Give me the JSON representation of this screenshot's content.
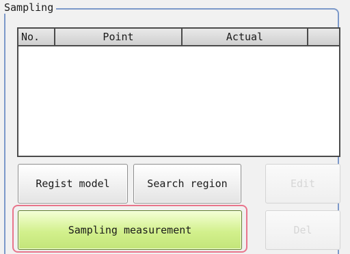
{
  "group": {
    "title": "Sampling"
  },
  "table": {
    "columns": [
      "No.",
      "Point",
      "Actual",
      ""
    ],
    "rows": []
  },
  "buttons": {
    "regist_model": "Regist model",
    "search_region": "Search region",
    "edit": "Edit",
    "sampling_measurement": "Sampling measurement",
    "del": "Del"
  },
  "colors": {
    "group_border": "#7b98c9",
    "sampling_button": "#d2f08c",
    "highlight_frame": "#e8748b"
  }
}
